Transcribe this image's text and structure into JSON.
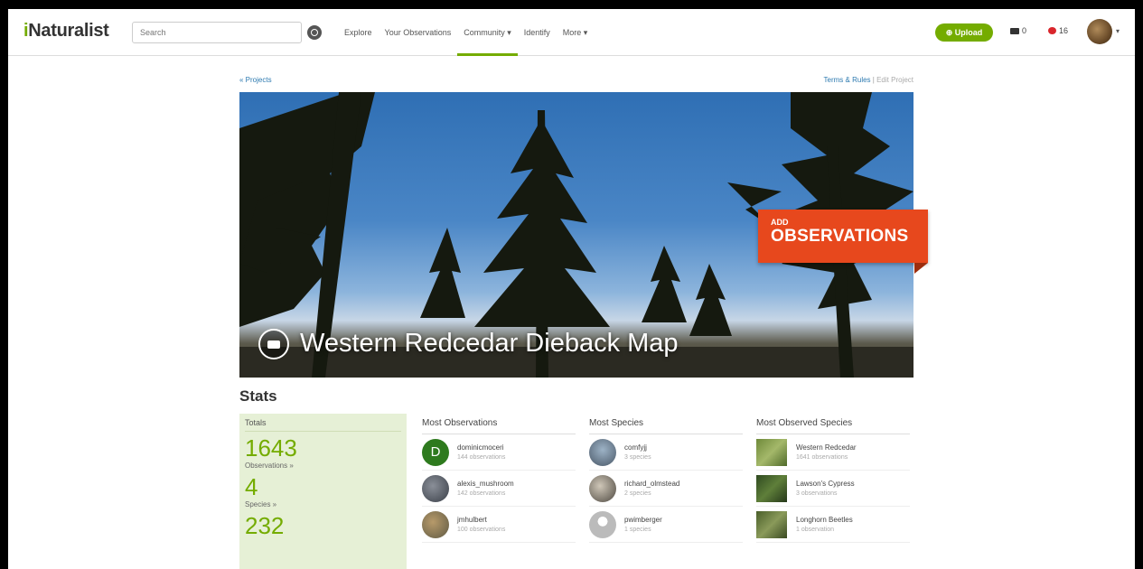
{
  "header": {
    "logo_prefix": "i",
    "logo_rest": "Naturalist",
    "search_placeholder": "Search",
    "nav": [
      {
        "label": "Explore"
      },
      {
        "label": "Your Observations"
      },
      {
        "label": "Community ▾"
      },
      {
        "label": "Identify"
      },
      {
        "label": "More ▾"
      }
    ],
    "upload_label": "⊕ Upload",
    "messages_count": "0",
    "notifications_count": "16",
    "avatar_caret": "▾"
  },
  "page": {
    "projects_link": "« Projects",
    "terms_link": "Terms & Rules",
    "separator": "|",
    "edit_link": "Edit Project"
  },
  "banner": {
    "title": "Western Redcedar Dieback Map",
    "add_small": "ADD",
    "add_big": "OBSERVATIONS"
  },
  "stats": {
    "title": "Stats",
    "totals": {
      "header": "Totals",
      "observations_count": "1643",
      "observations_label": "Observations »",
      "species_count": "4",
      "species_label": "Species »",
      "third_count": "232"
    },
    "most_observations": {
      "header": "Most Observations",
      "rows": [
        {
          "name": "dominicmoceri",
          "sub": "144 observations",
          "initial": "D"
        },
        {
          "name": "alexis_mushroom",
          "sub": "142 observations"
        },
        {
          "name": "jmhulbert",
          "sub": "100 observations"
        }
      ]
    },
    "most_species": {
      "header": "Most Species",
      "rows": [
        {
          "name": "comfyjj",
          "sub": "3 species"
        },
        {
          "name": "richard_olmstead",
          "sub": "2 species"
        },
        {
          "name": "pwimberger",
          "sub": "1 species"
        }
      ]
    },
    "most_observed_species": {
      "header": "Most Observed Species",
      "rows": [
        {
          "name": "Western Redcedar",
          "sub": "1641 observations"
        },
        {
          "name": "Lawson's Cypress",
          "sub": "3 observations"
        },
        {
          "name": "Longhorn Beetles",
          "sub": "1 observation"
        }
      ]
    }
  },
  "colors": {
    "brand_green": "#74ac00",
    "add_observations_orange": "#e7481d",
    "link_blue": "#2d7ab0"
  }
}
